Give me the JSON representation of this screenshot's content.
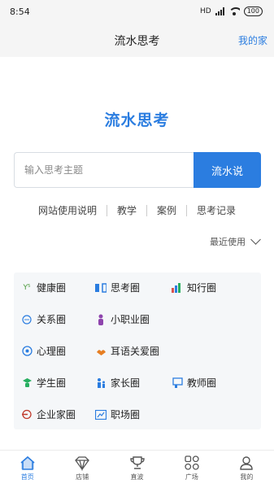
{
  "status": {
    "time": "8:54",
    "network": "HD",
    "battery": "100"
  },
  "nav": {
    "title": "流水思考",
    "right_link": "我的家"
  },
  "brand": "流水思考",
  "search": {
    "placeholder": "输入思考主题",
    "value": "",
    "button": "流水说"
  },
  "links": [
    "网站使用说明",
    "教学",
    "案例",
    "思考记录"
  ],
  "recent": {
    "label": "最近使用"
  },
  "circles": [
    {
      "label": "健康圈",
      "icon": "health-icon",
      "color": "#4a9a3c"
    },
    {
      "label": "思考圈",
      "icon": "thinking-icon",
      "color": "#2b7de0"
    },
    {
      "label": "知行圈",
      "icon": "knowledge-icon",
      "color": "#d9534f"
    },
    {
      "label": "关系圈",
      "icon": "chat-icon",
      "color": "#2b7de0"
    },
    {
      "label": "小职业圈",
      "icon": "person-icon",
      "color": "#8e44ad"
    },
    {
      "label": "心理圈",
      "icon": "mind-icon",
      "color": "#2b7de0"
    },
    {
      "label": "耳语关爱圈",
      "icon": "care-icon",
      "color": "#e67e22"
    },
    {
      "label": "学生圈",
      "icon": "student-icon",
      "color": "#27ae60"
    },
    {
      "label": "家长圈",
      "icon": "parent-icon",
      "color": "#2b7de0"
    },
    {
      "label": "教师圈",
      "icon": "teacher-icon",
      "color": "#2b7de0"
    },
    {
      "label": "企业家圈",
      "icon": "entrepreneur-icon",
      "color": "#c0392b"
    },
    {
      "label": "职场圈",
      "icon": "workplace-icon",
      "color": "#2b7de0"
    }
  ],
  "tabs": [
    {
      "label": "首页",
      "icon": "home-icon",
      "active": true
    },
    {
      "label": "店铺",
      "icon": "diamond-icon",
      "active": false
    },
    {
      "label": "直波",
      "icon": "trophy-icon",
      "active": false
    },
    {
      "label": "广场",
      "icon": "grid-icon",
      "active": false
    },
    {
      "label": "我的",
      "icon": "profile-icon",
      "active": false
    }
  ],
  "colors": {
    "accent": "#2b7de0",
    "panel": "#f5f7f9",
    "bar": "#f5f5f5"
  }
}
